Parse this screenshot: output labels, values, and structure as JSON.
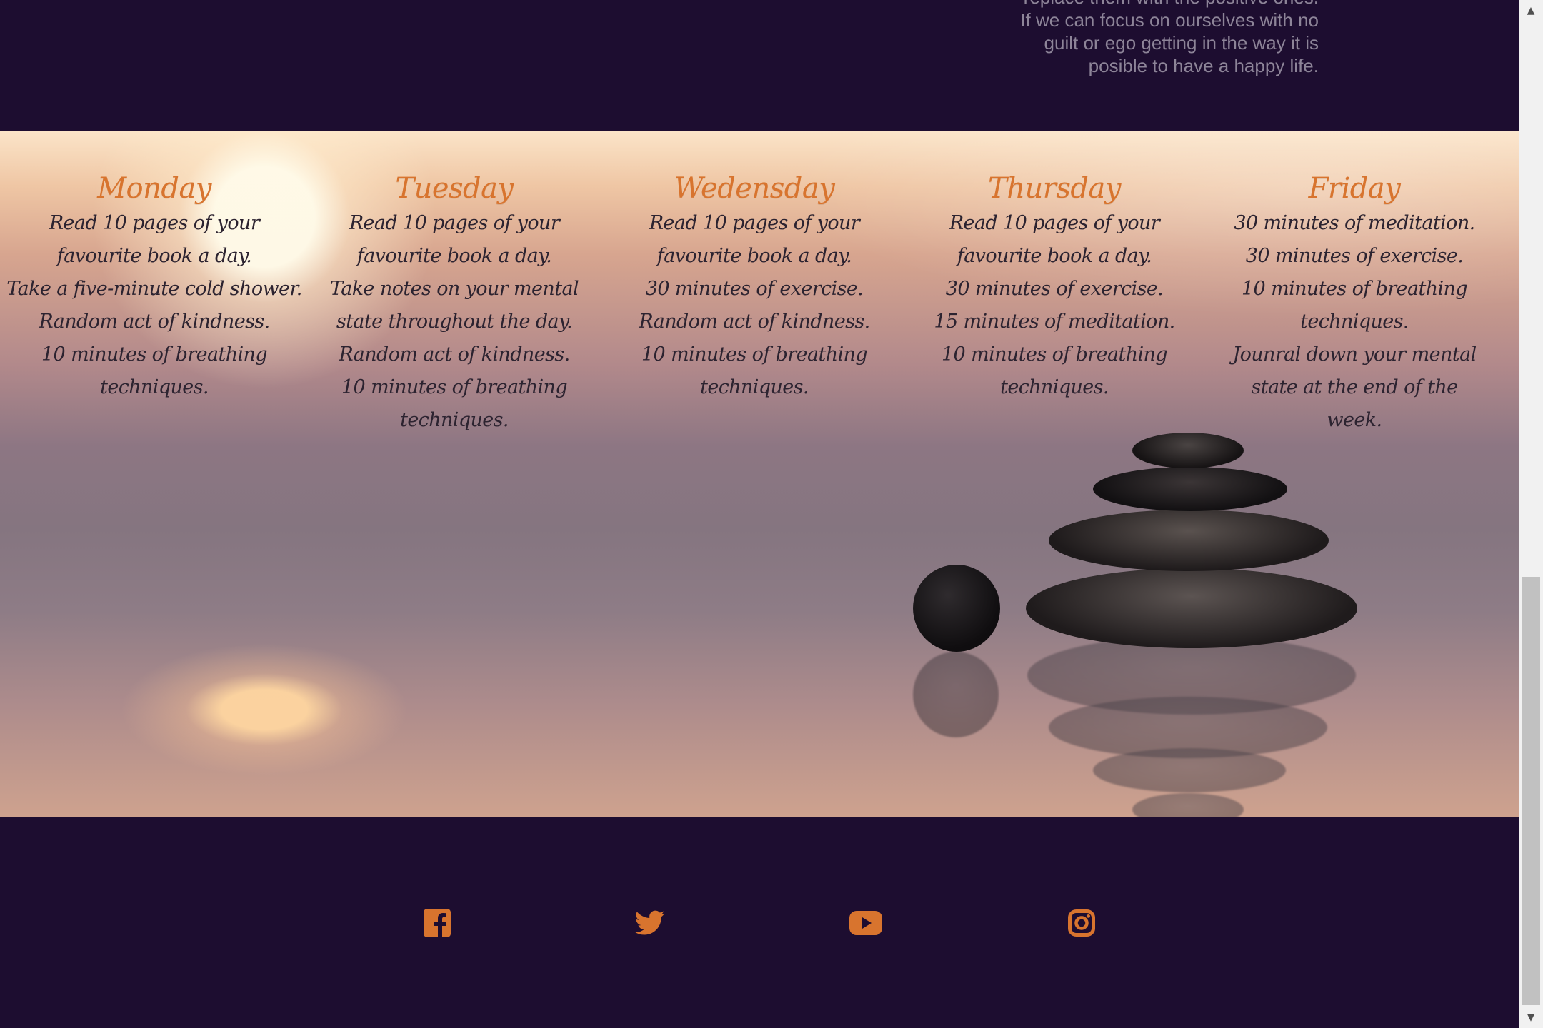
{
  "intro": {
    "lines": [
      "replace them with the positive ones.",
      "If we can focus on ourselves with no",
      "guilt or ego getting in the way it is",
      "posible to have a happy life."
    ]
  },
  "schedule": {
    "days": [
      {
        "title": "Monday",
        "tasks": [
          "Read 10 pages of your favourite book a day.",
          "Take a five-minute cold shower.",
          "Random act of kindness.",
          "10 minutes of breathing techniques."
        ]
      },
      {
        "title": "Tuesday",
        "tasks": [
          "Read 10 pages of your favourite book a day.",
          "Take notes on your mental state throughout the day.",
          "Random act of kindness.",
          "10 minutes of breathing techniques."
        ]
      },
      {
        "title": "Wedensday",
        "tasks": [
          "Read 10 pages of your favourite book a day.",
          "30 minutes of exercise.",
          "Random act of kindness.",
          "10 minutes of breathing techniques."
        ]
      },
      {
        "title": "Thursday",
        "tasks": [
          "Read 10 pages of your favourite book a day.",
          "30 minutes of exercise.",
          "15 minutes of meditation.",
          "10 minutes of breathing techniques."
        ]
      },
      {
        "title": "Friday",
        "tasks": [
          "30 minutes of meditation.",
          "30 minutes of exercise.",
          "10 minutes of breathing techniques.",
          "Jounral down your mental state at the end of the week."
        ]
      }
    ]
  },
  "footer": {
    "icon_color": "#d8742e",
    "socials": [
      {
        "name": "facebook-icon"
      },
      {
        "name": "twitter-icon"
      },
      {
        "name": "youtube-icon"
      },
      {
        "name": "instagram-icon"
      }
    ]
  },
  "colors": {
    "background": "#1d0d30",
    "accent": "#d8742e",
    "task_text": "#2c2330"
  }
}
